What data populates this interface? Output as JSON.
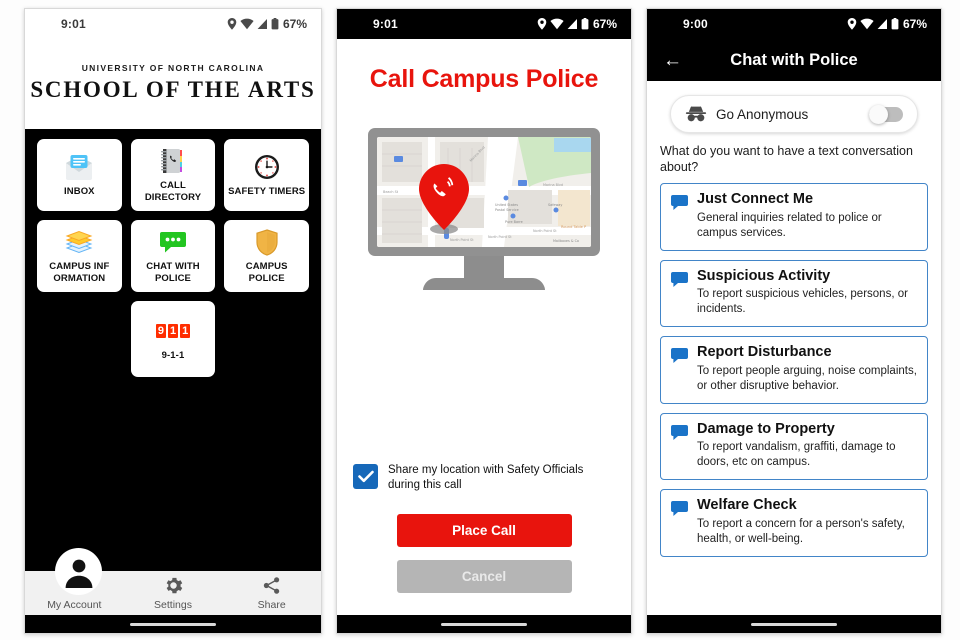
{
  "phone1": {
    "status": {
      "time": "9:01",
      "battery": "67%"
    },
    "logo": {
      "line1": "UNIVERSITY OF NORTH CAROLINA",
      "line2": "SCHOOL OF THE ARTS"
    },
    "tiles": [
      {
        "label": "INBOX",
        "icon": "inbox-envelope-icon"
      },
      {
        "label": "CALL DIRECTORY",
        "icon": "phone-book-icon"
      },
      {
        "label": "SAFETY TIMERS",
        "icon": "clock-icon"
      },
      {
        "label": "CAMPUS INF ORMATION",
        "icon": "books-icon"
      },
      {
        "label": "CHAT WITH POLICE",
        "icon": "chat-bubble-icon"
      },
      {
        "label": "CAMPUS POLICE",
        "icon": "shield-icon"
      }
    ],
    "emergency_tile": {
      "digits": [
        "9",
        "1",
        "1"
      ],
      "label": "9-1-1",
      "icon": "911-icon"
    },
    "nav": [
      {
        "label": "My Account",
        "icon": "person-icon"
      },
      {
        "label": "Settings",
        "icon": "gear-icon"
      },
      {
        "label": "Share",
        "icon": "share-icon"
      }
    ]
  },
  "phone2": {
    "status": {
      "time": "9:01",
      "battery": "67%"
    },
    "title": "Call Campus Police",
    "artwork": "monitor-map-phone-pin-illustration",
    "checkbox": {
      "label": "Share my location with Safety Officials during this call",
      "checked": true
    },
    "primary_button": "Place Call",
    "secondary_button": "Cancel",
    "colors": {
      "accent_red": "#e8140d",
      "checkbox_blue": "#1668b9",
      "cancel_gray": "#b5b5b5"
    }
  },
  "phone3": {
    "status": {
      "time": "9:00",
      "battery": "67%"
    },
    "appbar": {
      "back": "←",
      "title": "Chat with Police"
    },
    "anonymous": {
      "label": "Go Anonymous",
      "icon": "incognito-icon",
      "enabled": false
    },
    "prompt": "What do you want to have a text conversation about?",
    "topics": [
      {
        "title": "Just Connect Me",
        "desc": "General inquiries related to police or campus services."
      },
      {
        "title": "Suspicious Activity",
        "desc": "To report suspicious vehicles, persons, or incidents."
      },
      {
        "title": "Report Disturbance",
        "desc": "To report people arguing, noise complaints, or other disruptive behavior."
      },
      {
        "title": "Damage to Property",
        "desc": "To report vandalism, graffiti, damage to doors, etc on campus."
      },
      {
        "title": "Welfare Check",
        "desc": "To report a concern for a person's safety, health, or well-being."
      }
    ],
    "colors": {
      "card_border": "#4285c8",
      "bubble_blue": "#1a73c8"
    }
  }
}
